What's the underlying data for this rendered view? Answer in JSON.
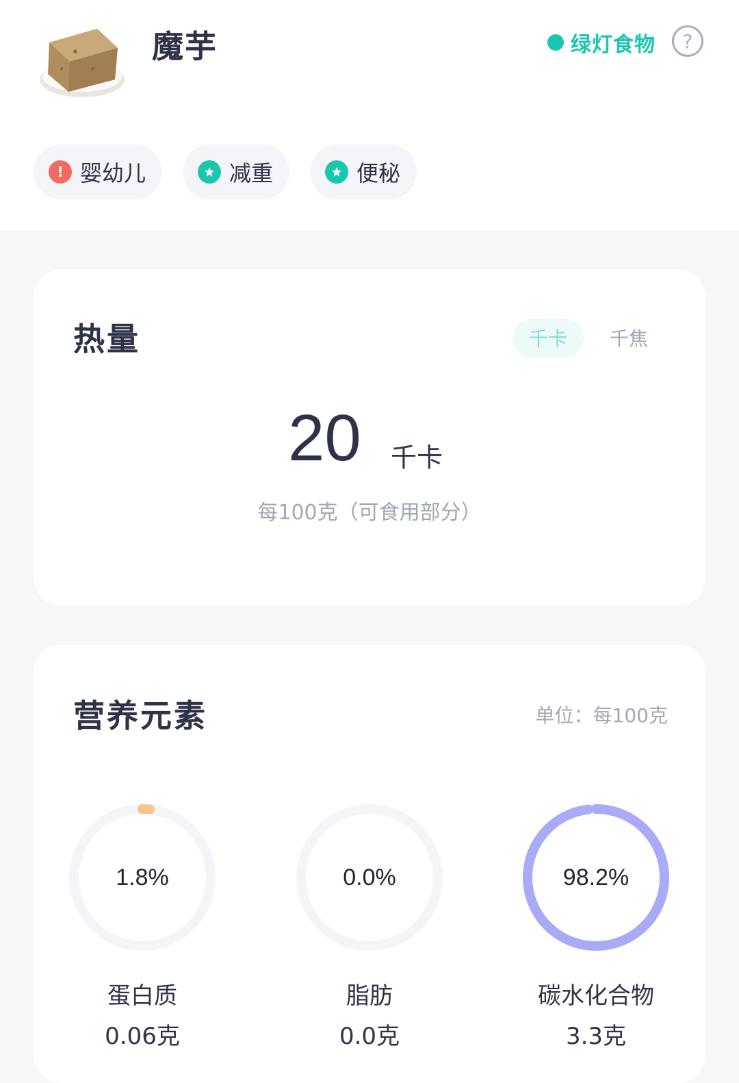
{
  "food": {
    "name": "魔芋",
    "light_label": "绿灯食物",
    "light_color": "#1ac7ae",
    "help_icon": "question-circle-icon",
    "thumbnail": "konjac-photo"
  },
  "tags": [
    {
      "label": "婴幼儿",
      "icon": "exclamation-icon",
      "color": "#f26b63"
    },
    {
      "label": "减重",
      "icon": "star-badge-icon",
      "color": "#1ac7ae"
    },
    {
      "label": "便秘",
      "icon": "star-badge-icon",
      "color": "#1ac7ae"
    }
  ],
  "energy": {
    "title": "热量",
    "unit_active": "千卡",
    "unit_other": "千焦",
    "value": "20",
    "value_unit": "千卡",
    "note": "每100克（可食用部分）"
  },
  "nutrition": {
    "title": "营养元素",
    "unit_note": "单位：每100克",
    "items": [
      {
        "name": "蛋白质",
        "percent_label": "1.8%",
        "percent": 1.8,
        "amount": "0.06克",
        "color": "#f7c58f"
      },
      {
        "name": "脂肪",
        "percent_label": "0.0%",
        "percent": 0.0,
        "amount": "0.0克",
        "color": "#7fd3c6"
      },
      {
        "name": "碳水化合物",
        "percent_label": "98.2%",
        "percent": 98.2,
        "amount": "3.3克",
        "color": "#a9abf7"
      }
    ]
  }
}
